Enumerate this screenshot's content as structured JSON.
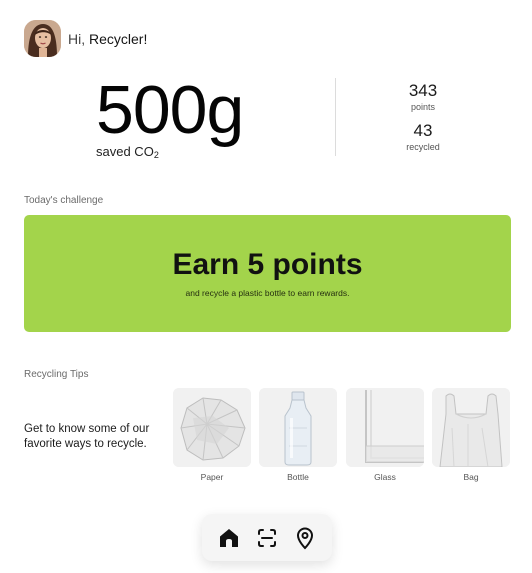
{
  "header": {
    "greeting_prefix": "Hi,",
    "greeting_name": " Recycler!",
    "avatar_icon": "user-avatar-photo"
  },
  "stats": {
    "co2_value": "500g",
    "co2_label": "saved CO",
    "co2_subscript": "2",
    "points_value": "343",
    "points_label": "points",
    "recycled_value": "43",
    "recycled_label": "recycled"
  },
  "challenge": {
    "section_title": "Today's challenge",
    "headline": "Earn 5 points",
    "description": "and recycle a plastic bottle to earn rewards.",
    "color": "#a3d44b"
  },
  "tips": {
    "section_title": "Recycling Tips",
    "intro": "Get to know some of our favorite ways to recycle.",
    "items": [
      {
        "label": "Paper",
        "icon": "crumpled-paper"
      },
      {
        "label": "Bottle",
        "icon": "plastic-bottle"
      },
      {
        "label": "Glass",
        "icon": "glass-jar"
      },
      {
        "label": "Bag",
        "icon": "plastic-bag"
      }
    ]
  },
  "nav": {
    "items": [
      {
        "name": "home",
        "icon": "home-icon",
        "active": true
      },
      {
        "name": "scan",
        "icon": "scan-icon",
        "active": false
      },
      {
        "name": "map",
        "icon": "location-pin-icon",
        "active": false
      }
    ]
  }
}
